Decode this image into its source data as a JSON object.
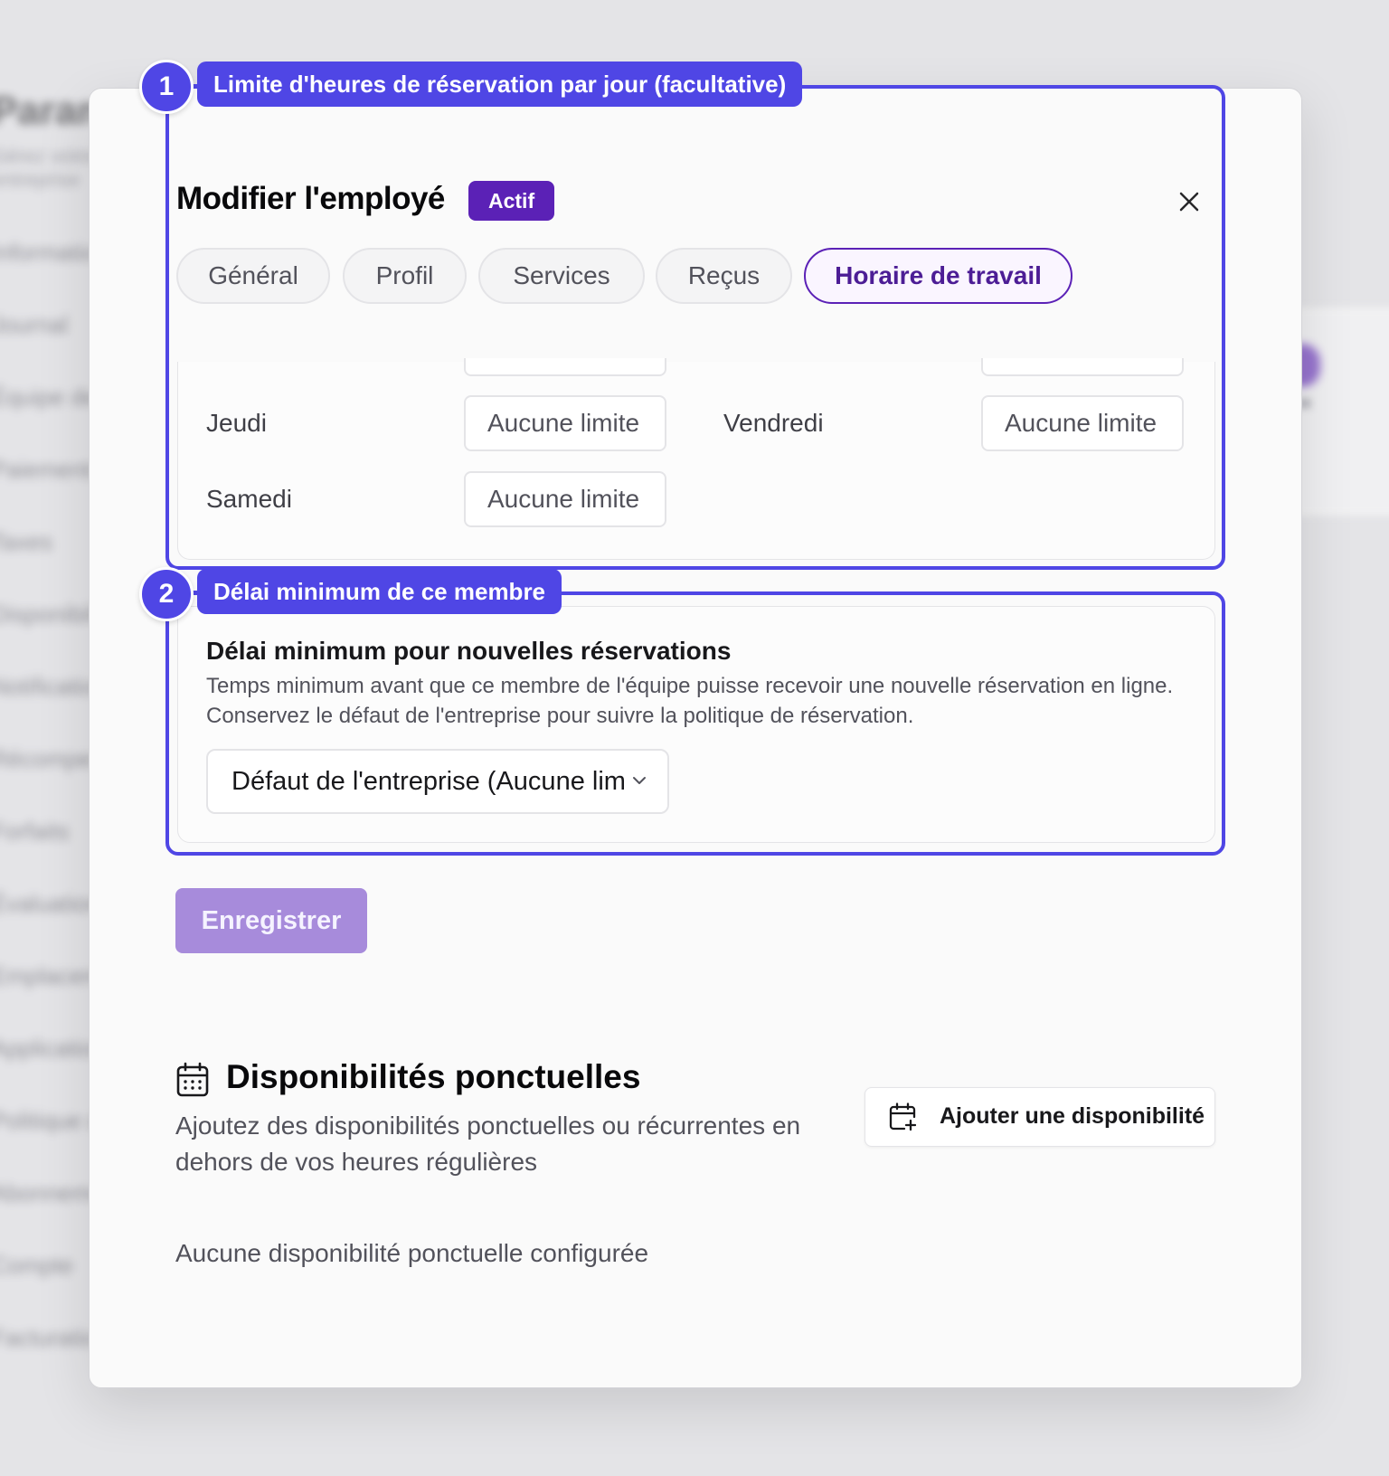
{
  "background": {
    "title": "Paramètres",
    "subtitle": "Gérez votre entreprise",
    "items": [
      "Informations",
      "Journal",
      "Équipe de travail",
      "Paiements",
      "Taxes",
      "Disponibilités",
      "Notifications",
      "Récompenses",
      "Forfaits",
      "Évaluations",
      "Emplacements",
      "Applications",
      "Politique de réservation",
      "Abonnement",
      "Compte",
      "Facturation"
    ]
  },
  "modal": {
    "title": "Modifier l'employé",
    "status_badge": "Actif",
    "tabs": [
      {
        "label": "Général",
        "active": false
      },
      {
        "label": "Profil",
        "active": false
      },
      {
        "label": "Services",
        "active": false
      },
      {
        "label": "Reçus",
        "active": false
      },
      {
        "label": "Horaire de travail",
        "active": true
      }
    ]
  },
  "daily_limits": {
    "days": [
      {
        "day": "Jeudi",
        "value": "Aucune limite"
      },
      {
        "day": "Vendredi",
        "value": "Aucune limite"
      },
      {
        "day": "Samedi",
        "value": "Aucune limite"
      }
    ]
  },
  "min_delay": {
    "title": "Délai minimum pour nouvelles réservations",
    "description": "Temps minimum avant que ce membre de l'équipe puisse recevoir une nouvelle réservation en ligne. Conservez le défaut de l'entreprise pour suivre la politique de réservation.",
    "selected": "Défaut de l'entreprise (Aucune limite)"
  },
  "save_label": "Enregistrer",
  "availability": {
    "title": "Disponibilités ponctuelles",
    "description": "Ajoutez des disponibilités ponctuelles ou récurrentes en dehors de vos heures régulières",
    "add_label": "Ajouter une disponibilité",
    "empty": "Aucune disponibilité ponctuelle configurée"
  },
  "annotations": [
    {
      "number": "1",
      "label": "Limite d'heures de réservation par jour (facultative)"
    },
    {
      "number": "2",
      "label": "Délai minimum de ce membre"
    }
  ],
  "colors": {
    "accent": "#5b21b6",
    "annotation": "#4f46e5",
    "save_button": "#a78bdb"
  },
  "icons": [
    "close-icon",
    "calendar-icon",
    "calendar-plus-icon",
    "chevron-down-icon"
  ]
}
